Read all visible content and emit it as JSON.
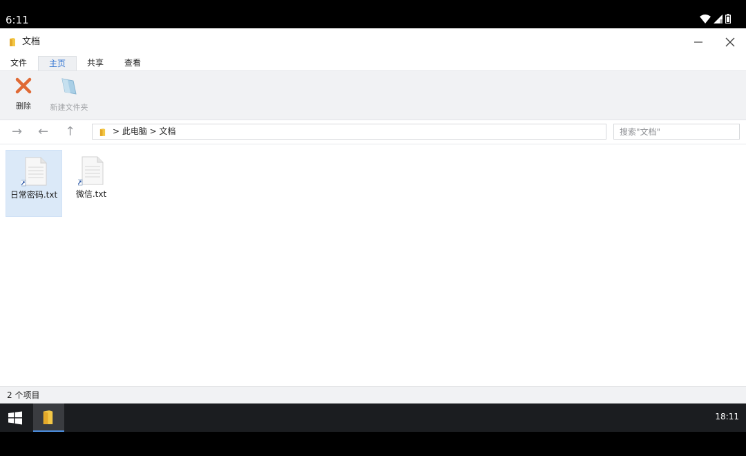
{
  "status_bar": {
    "time": "6:11"
  },
  "window": {
    "title": "文档",
    "menu_tabs": [
      {
        "label": "文件"
      },
      {
        "label": "主页",
        "active": true
      },
      {
        "label": "共享"
      },
      {
        "label": "查看"
      }
    ],
    "ribbon": {
      "delete_label": "删除",
      "new_folder_label": "新建文件夹"
    },
    "address": {
      "breadcrumb": "> 此电脑 > 文档",
      "search_placeholder": "搜索\"文档\""
    },
    "files": [
      {
        "name": "日常密码.txt",
        "selected": true
      },
      {
        "name": "微信.txt",
        "selected": false
      }
    ],
    "status_count": "2 个项目"
  },
  "taskbar": {
    "clock": "18:11"
  },
  "colors": {
    "accent": "#2a6fd1",
    "selection": "#dbe9f8",
    "delete_icon": "#e06a35",
    "taskbar": "#1b1d20"
  },
  "icons": [
    "folder-icon",
    "minimize-icon",
    "close-icon",
    "delete-icon",
    "new-folder-icon",
    "forward-arrow-icon",
    "back-arrow-icon",
    "up-arrow-icon",
    "text-file-shortcut-icon",
    "windows-start-icon",
    "wifi-icon",
    "cellular-signal-icon",
    "battery-icon"
  ]
}
